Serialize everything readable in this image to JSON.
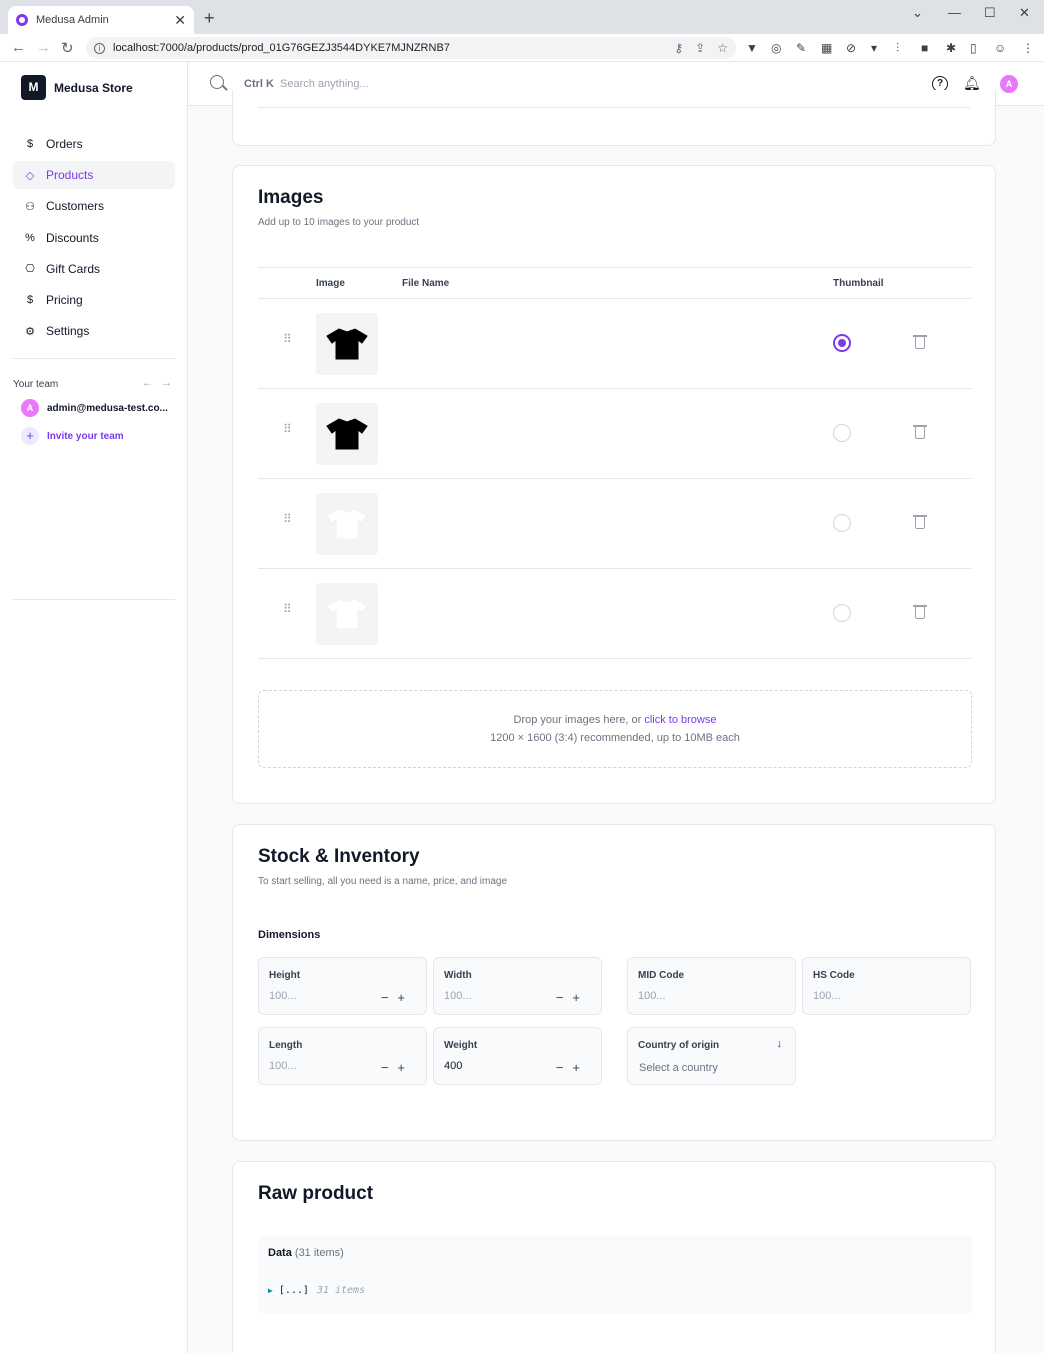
{
  "browser": {
    "tab_title": "Medusa Admin",
    "tab_close": "✕",
    "new_tab": "+",
    "url": "localhost:7000/a/products/prod_01G76GEZJ3544DYKE7MJNZRNB7"
  },
  "sidebar": {
    "store_initial": "M",
    "store_name": "Medusa Store",
    "items": [
      {
        "label": "Orders",
        "icon": "$"
      },
      {
        "label": "Products",
        "icon": "◇"
      },
      {
        "label": "Customers",
        "icon": "⚇"
      },
      {
        "label": "Discounts",
        "icon": "%"
      },
      {
        "label": "Gift Cards",
        "icon": "⎔"
      },
      {
        "label": "Pricing",
        "icon": "$"
      },
      {
        "label": "Settings",
        "icon": "⚙"
      }
    ],
    "team_label": "Your team",
    "member_initial": "A",
    "member_email": "admin@medusa-test.co...",
    "invite_label": "Invite your team"
  },
  "topbar": {
    "shortcut": "Ctrl K",
    "search_placeholder": "Search anything...",
    "user_initial": "A"
  },
  "images": {
    "title": "Images",
    "subtitle": "Add up to 10 images to your product",
    "columns": {
      "image": "Image",
      "file_name": "File Name",
      "thumbnail": "Thumbnail"
    },
    "rows": [
      {
        "tee_color": "#000000",
        "is_thumbnail": true
      },
      {
        "tee_color": "#000000",
        "is_thumbnail": false
      },
      {
        "tee_color": "#ffffff",
        "is_thumbnail": false
      },
      {
        "tee_color": "#ffffff",
        "is_thumbnail": false
      }
    ],
    "drop_text": "Drop your images here, or ",
    "drop_link": "click to browse",
    "drop_hint": "1200 × 1600 (3:4) recommended, up to 10MB each"
  },
  "stock": {
    "title": "Stock & Inventory",
    "subtitle": "To start selling, all you need is a name, price, and image",
    "dimensions_label": "Dimensions",
    "height": {
      "label": "Height",
      "placeholder": "100..."
    },
    "width": {
      "label": "Width",
      "placeholder": "100..."
    },
    "mid_code": {
      "label": "MID Code",
      "placeholder": "100..."
    },
    "hs_code": {
      "label": "HS Code",
      "placeholder": "100..."
    },
    "length": {
      "label": "Length",
      "placeholder": "100..."
    },
    "weight": {
      "label": "Weight",
      "value": "400"
    },
    "country": {
      "label": "Country of origin",
      "placeholder": "Select a country"
    }
  },
  "raw": {
    "title": "Raw product",
    "data_label": "Data",
    "data_count": "(31 items)",
    "json_preview": "[...]",
    "json_meta": "31 items"
  },
  "colors": {
    "accent": "#7c3aed",
    "avatar": "#e879f9"
  }
}
